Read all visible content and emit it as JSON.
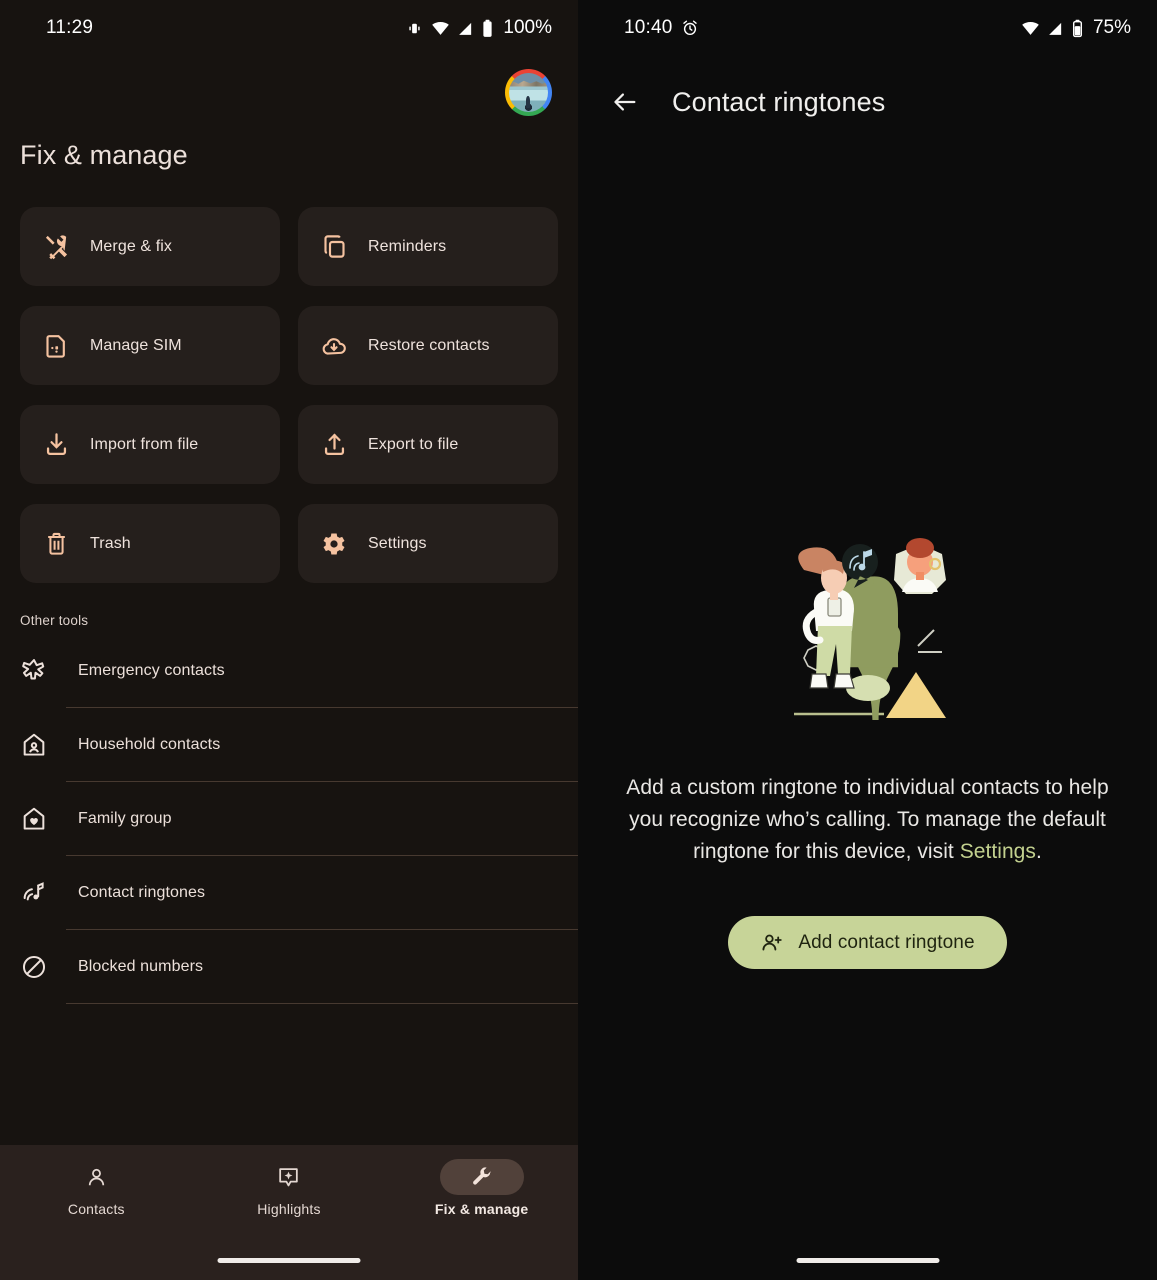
{
  "left_phone": {
    "status_bar": {
      "time": "11:29",
      "battery_pct": "100%",
      "icons": [
        "vibrate-icon",
        "wifi-icon",
        "signal-icon",
        "battery-icon"
      ]
    },
    "avatar": {
      "name": "account-avatar"
    },
    "page_title": "Fix & manage",
    "tiles": [
      {
        "label": "Merge & fix",
        "icon": "merge-fix-icon"
      },
      {
        "label": "Reminders",
        "icon": "reminders-icon"
      },
      {
        "label": "Manage SIM",
        "icon": "sim-card-icon"
      },
      {
        "label": "Restore contacts",
        "icon": "cloud-download-icon"
      },
      {
        "label": "Import from file",
        "icon": "import-icon"
      },
      {
        "label": "Export to file",
        "icon": "export-icon"
      },
      {
        "label": "Trash",
        "icon": "trash-icon"
      },
      {
        "label": "Settings",
        "icon": "gear-icon"
      }
    ],
    "other_tools_header": "Other tools",
    "other_tools": [
      {
        "label": "Emergency contacts",
        "icon": "medical-star-icon"
      },
      {
        "label": "Household contacts",
        "icon": "house-person-icon"
      },
      {
        "label": "Family group",
        "icon": "house-heart-icon"
      },
      {
        "label": "Contact ringtones",
        "icon": "ringtone-note-icon"
      },
      {
        "label": "Blocked numbers",
        "icon": "block-icon"
      }
    ],
    "bottom_nav": [
      {
        "label": "Contacts",
        "icon": "person-icon",
        "active": false
      },
      {
        "label": "Highlights",
        "icon": "sparkle-icon",
        "active": false
      },
      {
        "label": "Fix & manage",
        "icon": "wrench-icon",
        "active": true
      }
    ]
  },
  "right_phone": {
    "status_bar": {
      "time": "10:40",
      "battery_pct": "75%",
      "icons": [
        "alarm-icon",
        "wifi-icon",
        "signal-icon",
        "battery-icon"
      ]
    },
    "back_icon": "back-arrow-icon",
    "title": "Contact ringtones",
    "illustration": "ringtone-bell-illustration",
    "empty_text_part1": "Add a custom ringtone to individual contacts to help you recognize who’s calling. To manage the default ringtone for this device, visit ",
    "empty_text_link": "Settings",
    "empty_text_part2": ".",
    "cta_label": "Add contact ringtone",
    "cta_icon": "person-add-icon"
  },
  "colors": {
    "page_bg_left": "#171310",
    "page_bg_right": "#0c0c0c",
    "tile_bg": "#251f1c",
    "tile_icon": "#f5c2a0",
    "text_primary": "#ece0da",
    "divider": "#473930",
    "nav_bar_bg": "#2a211e",
    "nav_pill_active": "#51413a",
    "cta_bg": "#c7d498",
    "link": "#c3d18f"
  }
}
